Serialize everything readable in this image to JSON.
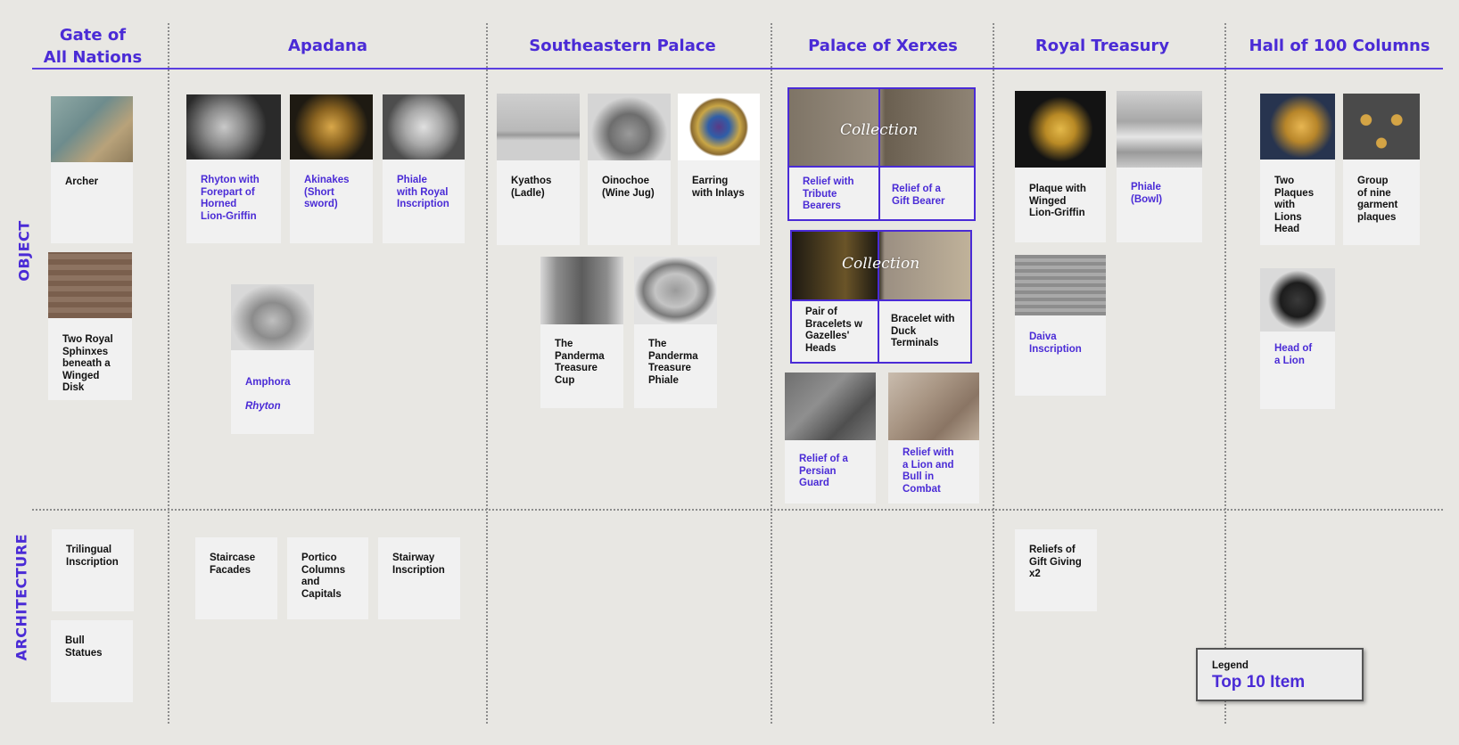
{
  "columns": [
    {
      "title": "Gate of\nAll Nations"
    },
    {
      "title": "Apadana"
    },
    {
      "title": "Southeastern Palace"
    },
    {
      "title": "Palace of Xerxes"
    },
    {
      "title": "Royal Treasury"
    },
    {
      "title": "Hall of 100 Columns"
    }
  ],
  "rows": {
    "object": "OBJECT",
    "architecture": "ARCHITECTURE"
  },
  "colors": {
    "accent": "#4a2bd6",
    "background": "#e8e7e3",
    "card": "#f1f1f1",
    "text": "#111111"
  },
  "objects": {
    "archer": {
      "label": "Archer",
      "top10": false
    },
    "sphinxes": {
      "label": "Two Royal\nSphinxes\nbeneath a\nWinged\nDisk",
      "top10": false
    },
    "rhyton": {
      "label": "Rhyton with\nForepart of\nHorned\nLion-Griffin",
      "top10": true
    },
    "akinakes": {
      "label": "Akinakes\n(Short\nsword)",
      "top10": true
    },
    "phiale_royal": {
      "label": "Phiale\nwith Royal\nInscription",
      "top10": true
    },
    "amphora_a": "Amphora",
    "amphora_b": "Rhyton",
    "kyathos": {
      "label": "Kyathos\n(Ladle)",
      "top10": false
    },
    "oinochoe": {
      "label": "Oinochoe\n(Wine Jug)",
      "top10": false
    },
    "earring": {
      "label": "Earring\nwith Inlays",
      "top10": false
    },
    "cup": {
      "label": "The\nPanderma\nTreasure\nCup",
      "top10": false
    },
    "phiale_pan": {
      "label": "The\nPanderma\nTreasure\nPhiale",
      "top10": false
    },
    "tribute": {
      "label": "Relief with\nTribute\nBearers",
      "top10": true
    },
    "giftbearer": {
      "label": "Relief of a\nGift Bearer",
      "top10": true
    },
    "bracelets": {
      "label": "Pair of\nBracelets w\nGazelles'\nHeads",
      "top10": false
    },
    "duck": {
      "label": "Bracelet with\nDuck\nTerminals",
      "top10": false
    },
    "guard": {
      "label": "Relief of a\nPersian\nGuard",
      "top10": true
    },
    "lionbull": {
      "label": "Relief with\na Lion and\nBull in\nCombat",
      "top10": true
    },
    "plaque": {
      "label": "Plaque with\nWinged\nLion-Griffin",
      "top10": false
    },
    "bowl": {
      "label": "Phiale\n(Bowl)",
      "top10": true
    },
    "daiva": {
      "label": "Daiva\nInscription",
      "top10": true
    },
    "twoplaques": {
      "label": "Two\nPlaques\nwith\nLions\nHead",
      "top10": false
    },
    "nine": {
      "label": "Group\nof nine\ngarment\nplaques",
      "top10": false
    },
    "headlion": {
      "label": "Head of\na Lion",
      "top10": true
    }
  },
  "collection_word": "Collection",
  "architecture": {
    "trilingual": "Trilingual\nInscription",
    "bull": "Bull\nStatues",
    "staircase": "Staircase\nFacades",
    "portico": "Portico\nColumns\nand\nCapitals",
    "stairway": "Stairway\nInscription",
    "reliefs_gift": "Reliefs of\nGift Giving\nx2"
  },
  "legend": {
    "title": "Legend",
    "value": "Top 10 Item"
  }
}
